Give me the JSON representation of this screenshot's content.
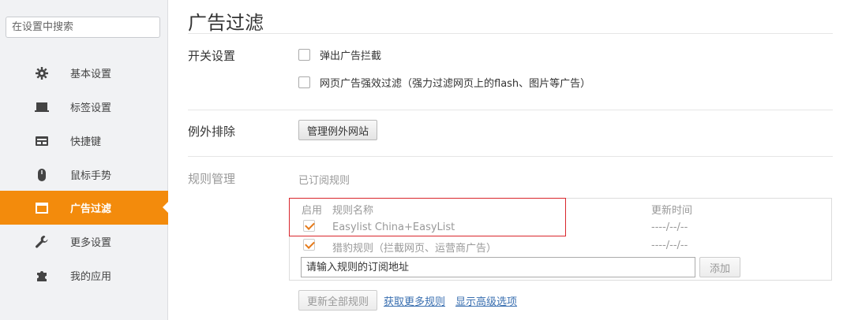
{
  "sidebar": {
    "search_placeholder": "在设置中搜索",
    "items": [
      {
        "label": "基本设置",
        "icon": "gear-icon"
      },
      {
        "label": "标签设置",
        "icon": "tab-icon"
      },
      {
        "label": "快捷键",
        "icon": "keyboard-icon"
      },
      {
        "label": "鼠标手势",
        "icon": "mouse-icon"
      },
      {
        "label": "广告过滤",
        "icon": "window-icon",
        "active": true
      },
      {
        "label": "更多设置",
        "icon": "wrench-icon"
      },
      {
        "label": "我的应用",
        "icon": "puzzle-icon"
      }
    ]
  },
  "main": {
    "title": "广告过滤",
    "switch_section": {
      "label": "开关设置",
      "options": [
        {
          "label": "弹出广告拦截",
          "checked": false
        },
        {
          "label": "网页广告强效过滤（强力过滤网页上的flash、图片等广告）",
          "checked": false
        }
      ]
    },
    "exception_section": {
      "label": "例外排除",
      "button": "管理例外网站"
    },
    "rules_section": {
      "label": "规则管理",
      "subscribed_label": "已订阅规则",
      "columns": {
        "enabled": "启用",
        "name": "规则名称",
        "updated": "更新时间"
      },
      "rules": [
        {
          "name": "Easylist China+EasyList",
          "updated": "----/--/--",
          "enabled": true
        },
        {
          "name": "猎豹规则（拦截网页、运营商广告）",
          "updated": "----/--/--",
          "enabled": true
        }
      ],
      "input_placeholder": "请输入规则的订阅地址",
      "add_button": "添加",
      "update_all_button": "更新全部规则",
      "get_more_link": "获取更多规则",
      "advanced_link": "显示高级选项"
    }
  },
  "colors": {
    "accent": "#f38b0c",
    "highlight_box": "#d9262c",
    "link": "#3a6fb0"
  }
}
